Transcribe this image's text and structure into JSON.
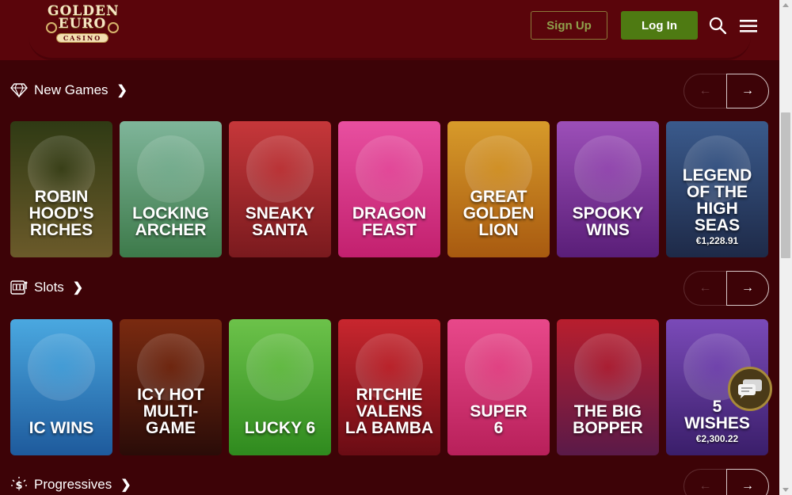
{
  "logo": {
    "line1": "GOLDEN",
    "line2": "EURO",
    "line3": "CASINO"
  },
  "header": {
    "signup_label": "Sign Up",
    "login_label": "Log In",
    "search_icon": "search-icon",
    "menu_icon": "hamburger-menu-icon"
  },
  "sections": [
    {
      "title": "New Games",
      "icon": "diamond-icon",
      "games": [
        {
          "name": "ROBIN HOOD'S\nRICHES",
          "jackpot": "",
          "color1": "#2f3a14",
          "color2": "#6b5a2a"
        },
        {
          "name": "LOCKING\nARCHER",
          "jackpot": "",
          "color1": "#7fb59a",
          "color2": "#3d7a4a"
        },
        {
          "name": "SNEAKY\nSANTA",
          "jackpot": "",
          "color1": "#c6373a",
          "color2": "#7a1a1e"
        },
        {
          "name": "DRAGON\nFEAST",
          "jackpot": "",
          "color1": "#e84fa0",
          "color2": "#c2206e"
        },
        {
          "name": "GREAT\nGOLDEN\nLION",
          "jackpot": "",
          "color1": "#d79a2a",
          "color2": "#a85a10"
        },
        {
          "name": "SPOOKY\nWINS",
          "jackpot": "",
          "color1": "#9c4fb8",
          "color2": "#5a1e78"
        },
        {
          "name": "LEGEND\nOF THE HIGH\nSEAS",
          "jackpot": "€1,228.91",
          "color1": "#3a5a8c",
          "color2": "#1e2a48"
        }
      ]
    },
    {
      "title": "Slots",
      "icon": "slot-machine-icon",
      "games": [
        {
          "name": "IC WINS",
          "jackpot": "",
          "color1": "#4aa8e0",
          "color2": "#1e5a9c"
        },
        {
          "name": "ICY HOT\nMULTI-GAME",
          "jackpot": "",
          "color1": "#7a2a10",
          "color2": "#2a0c08"
        },
        {
          "name": "LUCKY 6",
          "jackpot": "",
          "color1": "#6cc24a",
          "color2": "#2f8a1e"
        },
        {
          "name": "RITCHIE\nVALENS\nLA BAMBA",
          "jackpot": "",
          "color1": "#c8262e",
          "color2": "#6a0c14"
        },
        {
          "name": "SUPER\n6",
          "jackpot": "",
          "color1": "#e8488a",
          "color2": "#b8205a"
        },
        {
          "name": "THE BIG\nBOPPER",
          "jackpot": "",
          "color1": "#b81e2e",
          "color2": "#5a1a48"
        },
        {
          "name": "5\nWISHES",
          "jackpot": "€2,300.22",
          "color1": "#7a4ab8",
          "color2": "#3a1e6a"
        }
      ]
    },
    {
      "title": "Progressives",
      "icon": "dollar-rays-icon",
      "games": []
    }
  ],
  "nav": {
    "prev": "←",
    "next": "→"
  },
  "chat": {
    "icon": "chat-icon"
  }
}
